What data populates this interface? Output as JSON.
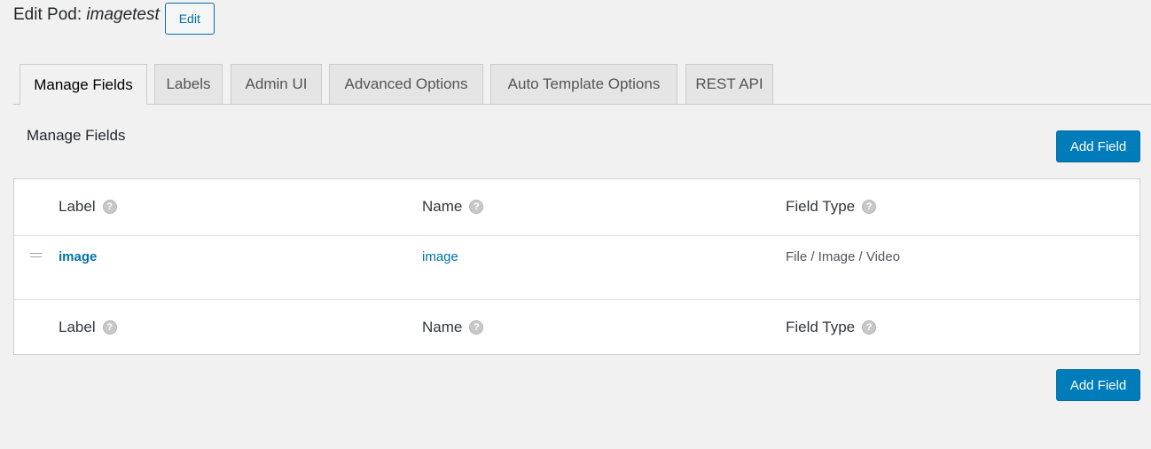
{
  "header": {
    "title_prefix": "Edit Pod: ",
    "pod_name": "imagetest",
    "edit_label": "Edit"
  },
  "tabs": [
    {
      "label": "Manage Fields",
      "active": true
    },
    {
      "label": "Labels",
      "active": false
    },
    {
      "label": "Admin UI",
      "active": false
    },
    {
      "label": "Advanced Options",
      "active": false
    },
    {
      "label": "Auto Template Options",
      "active": false
    },
    {
      "label": "REST API",
      "active": false
    }
  ],
  "section": {
    "title": "Manage Fields",
    "add_field_label": "Add Field"
  },
  "table": {
    "columns": [
      "Label",
      "Name",
      "Field Type"
    ],
    "help_icon": "question-mark-icon",
    "rows": [
      {
        "label": "image",
        "name": "image",
        "type": "File / Image / Video"
      }
    ]
  },
  "colors": {
    "primary": "#007cba",
    "link": "#0073aa",
    "background": "#f1f1f1"
  }
}
